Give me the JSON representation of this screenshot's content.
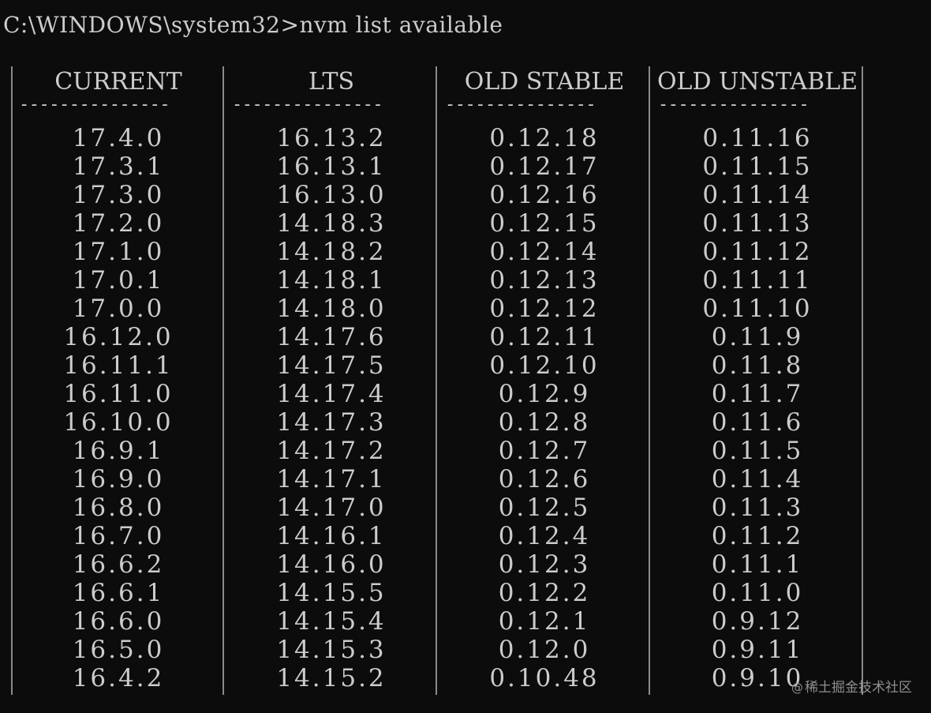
{
  "terminal": {
    "prompt": "C:\\WINDOWS\\system32>",
    "command": "nvm list available"
  },
  "table": {
    "columns": [
      {
        "header": "CURRENT",
        "separator": "---------------",
        "values": [
          "17.4.0",
          "17.3.1",
          "17.3.0",
          "17.2.0",
          "17.1.0",
          "17.0.1",
          "17.0.0",
          "16.12.0",
          "16.11.1",
          "16.11.0",
          "16.10.0",
          "16.9.1",
          "16.9.0",
          "16.8.0",
          "16.7.0",
          "16.6.2",
          "16.6.1",
          "16.6.0",
          "16.5.0",
          "16.4.2"
        ]
      },
      {
        "header": "LTS",
        "separator": "---------------",
        "values": [
          "16.13.2",
          "16.13.1",
          "16.13.0",
          "14.18.3",
          "14.18.2",
          "14.18.1",
          "14.18.0",
          "14.17.6",
          "14.17.5",
          "14.17.4",
          "14.17.3",
          "14.17.2",
          "14.17.1",
          "14.17.0",
          "14.16.1",
          "14.16.0",
          "14.15.5",
          "14.15.4",
          "14.15.3",
          "14.15.2"
        ]
      },
      {
        "header": "OLD STABLE",
        "separator": "---------------",
        "values": [
          "0.12.18",
          "0.12.17",
          "0.12.16",
          "0.12.15",
          "0.12.14",
          "0.12.13",
          "0.12.12",
          "0.12.11",
          "0.12.10",
          "0.12.9",
          "0.12.8",
          "0.12.7",
          "0.12.6",
          "0.12.5",
          "0.12.4",
          "0.12.3",
          "0.12.2",
          "0.12.1",
          "0.12.0",
          "0.10.48"
        ]
      },
      {
        "header": "OLD UNSTABLE",
        "separator": "---------------",
        "values": [
          "0.11.16",
          "0.11.15",
          "0.11.14",
          "0.11.13",
          "0.11.12",
          "0.11.11",
          "0.11.10",
          "0.11.9",
          "0.11.8",
          "0.11.7",
          "0.11.6",
          "0.11.5",
          "0.11.4",
          "0.11.3",
          "0.11.2",
          "0.11.1",
          "0.11.0",
          "0.9.12",
          "0.9.11",
          "0.9.10"
        ]
      }
    ]
  },
  "watermark": {
    "at": "@",
    "text": "稀土掘金技术社区"
  },
  "colors": {
    "background": "#0c0c0c",
    "foreground": "#cccccc",
    "border": "#8a8a8a"
  }
}
